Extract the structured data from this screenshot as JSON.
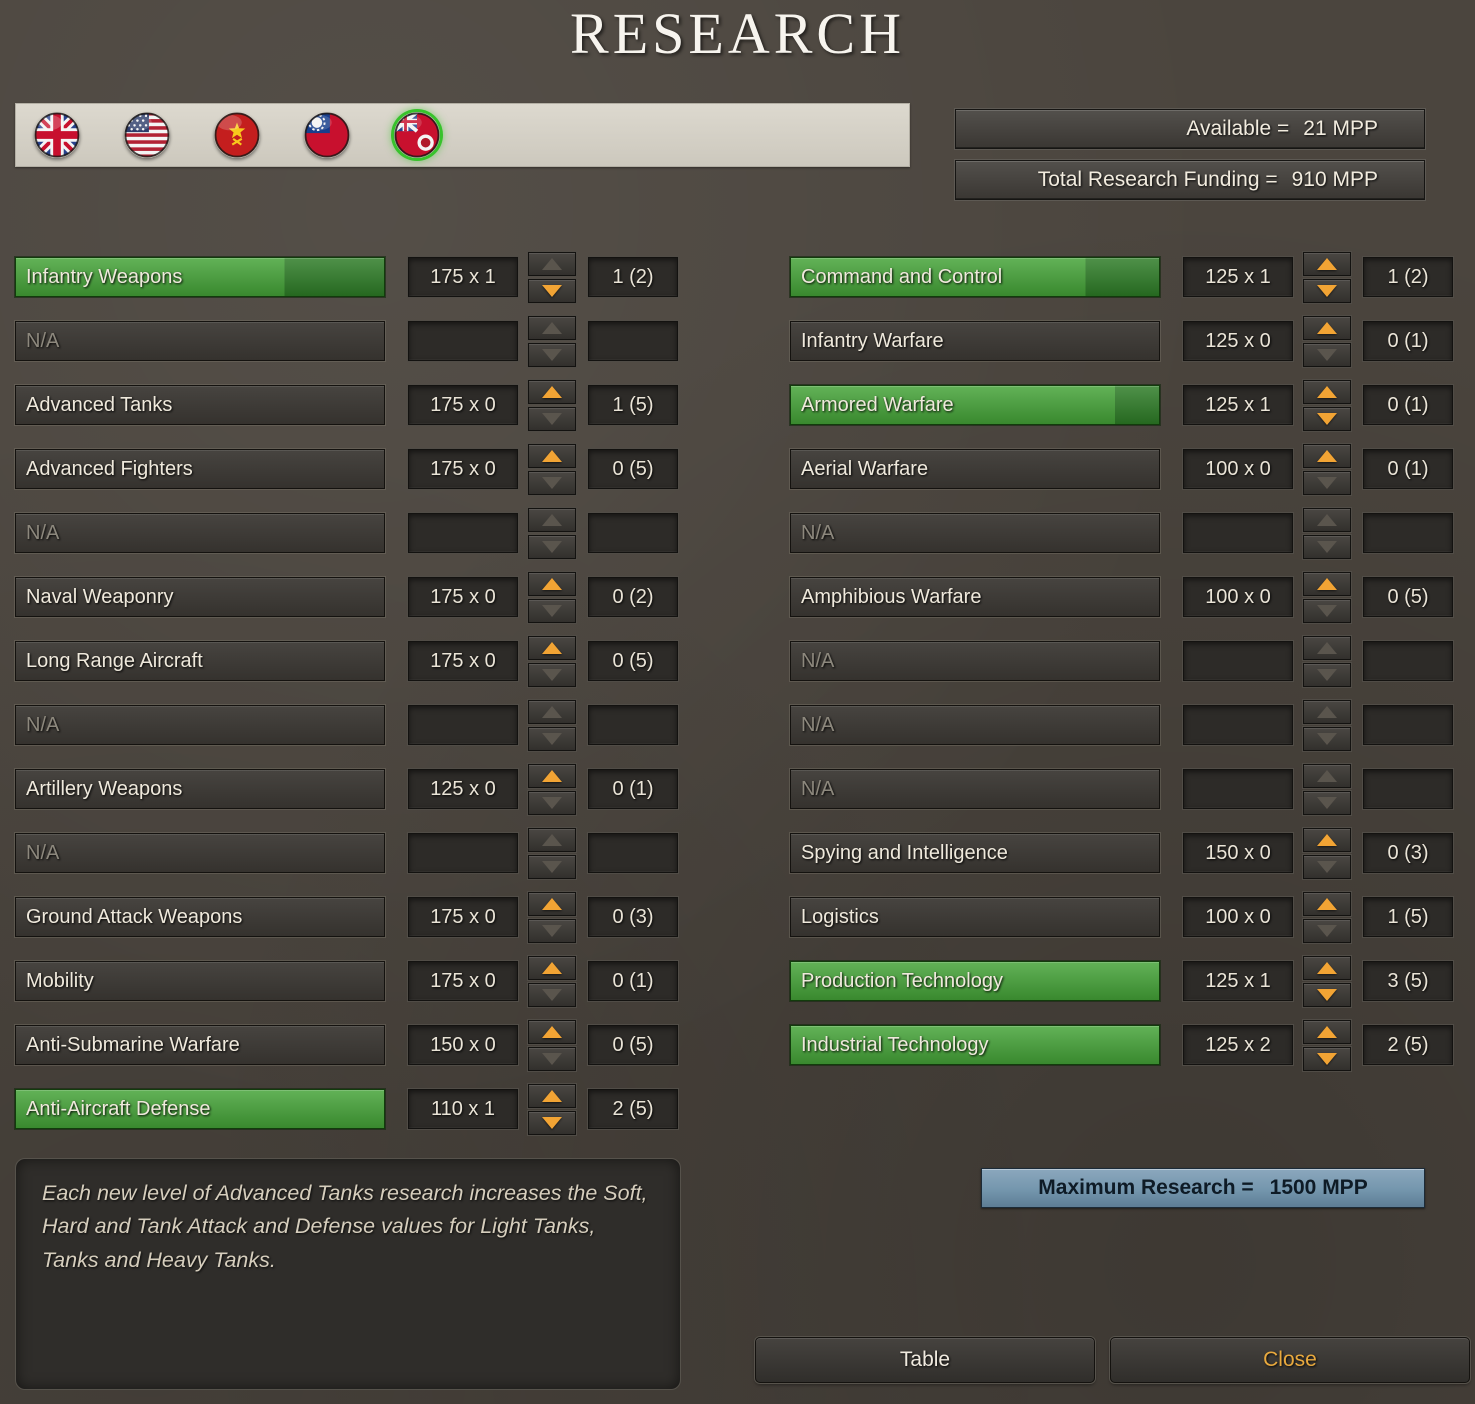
{
  "title": "RESEARCH",
  "flags": [
    {
      "id": "uk",
      "name": "United Kingdom",
      "selected": false
    },
    {
      "id": "usa",
      "name": "United States",
      "selected": false
    },
    {
      "id": "ussr",
      "name": "Soviet Union",
      "selected": false
    },
    {
      "id": "china",
      "name": "China",
      "selected": false
    },
    {
      "id": "selected-nation",
      "name": "Selected Nation",
      "selected": true
    }
  ],
  "funding": {
    "available_label": "Available =",
    "available_value": "21 MPP",
    "total_label": "Total Research Funding =",
    "total_value": "910 MPP"
  },
  "left_rows": [
    {
      "label": "Infantry Weapons",
      "cost": "175 x 1",
      "count": "1 (2)",
      "na": false,
      "highlight": true,
      "progress": 73,
      "up": false,
      "down": true
    },
    {
      "label": "N/A",
      "na": true
    },
    {
      "label": "Advanced Tanks",
      "cost": "175 x 0",
      "count": "1 (5)",
      "na": false,
      "highlight": false,
      "up": true,
      "down": false
    },
    {
      "label": "Advanced Fighters",
      "cost": "175 x 0",
      "count": "0 (5)",
      "na": false,
      "highlight": false,
      "up": true,
      "down": false
    },
    {
      "label": "N/A",
      "na": true
    },
    {
      "label": "Naval Weaponry",
      "cost": "175 x 0",
      "count": "0 (2)",
      "na": false,
      "highlight": false,
      "up": true,
      "down": false
    },
    {
      "label": "Long Range Aircraft",
      "cost": "175 x 0",
      "count": "0 (5)",
      "na": false,
      "highlight": false,
      "up": true,
      "down": false
    },
    {
      "label": "N/A",
      "na": true
    },
    {
      "label": "Artillery Weapons",
      "cost": "125 x 0",
      "count": "0 (1)",
      "na": false,
      "highlight": false,
      "up": true,
      "down": false
    },
    {
      "label": "N/A",
      "na": true
    },
    {
      "label": "Ground Attack Weapons",
      "cost": "175 x 0",
      "count": "0 (3)",
      "na": false,
      "highlight": false,
      "up": true,
      "down": false
    },
    {
      "label": "Mobility",
      "cost": "175 x 0",
      "count": "0 (1)",
      "na": false,
      "highlight": false,
      "up": true,
      "down": false
    },
    {
      "label": "Anti-Submarine Warfare",
      "cost": "150 x 0",
      "count": "0 (5)",
      "na": false,
      "highlight": false,
      "up": true,
      "down": false
    },
    {
      "label": "Anti-Aircraft Defense",
      "cost": "110 x 1",
      "count": "2 (5)",
      "na": false,
      "highlight": true,
      "progress": 100,
      "up": true,
      "down": true
    }
  ],
  "right_rows": [
    {
      "label": "Command and Control",
      "cost": "125 x 1",
      "count": "1 (2)",
      "na": false,
      "highlight": true,
      "progress": 80,
      "up": true,
      "down": true
    },
    {
      "label": "Infantry Warfare",
      "cost": "125 x 0",
      "count": "0 (1)",
      "na": false,
      "highlight": false,
      "up": true,
      "down": false
    },
    {
      "label": "Armored Warfare",
      "cost": "125 x 1",
      "count": "0 (1)",
      "na": false,
      "highlight": true,
      "progress": 88,
      "up": true,
      "down": true
    },
    {
      "label": "Aerial Warfare",
      "cost": "100 x 0",
      "count": "0 (1)",
      "na": false,
      "highlight": false,
      "up": true,
      "down": false
    },
    {
      "label": "N/A",
      "na": true
    },
    {
      "label": "Amphibious Warfare",
      "cost": "100 x 0",
      "count": "0 (5)",
      "na": false,
      "highlight": false,
      "up": true,
      "down": false
    },
    {
      "label": "N/A",
      "na": true
    },
    {
      "label": "N/A",
      "na": true
    },
    {
      "label": "N/A",
      "na": true
    },
    {
      "label": "Spying and Intelligence",
      "cost": "150 x 0",
      "count": "0 (3)",
      "na": false,
      "highlight": false,
      "up": true,
      "down": false
    },
    {
      "label": "Logistics",
      "cost": "100 x 0",
      "count": "1 (5)",
      "na": false,
      "highlight": false,
      "up": true,
      "down": false
    },
    {
      "label": "Production Technology",
      "cost": "125 x 1",
      "count": "3 (5)",
      "na": false,
      "highlight": true,
      "progress": 100,
      "up": true,
      "down": true
    },
    {
      "label": "Industrial Technology",
      "cost": "125 x 2",
      "count": "2 (5)",
      "na": false,
      "highlight": true,
      "progress": 100,
      "up": true,
      "down": true
    }
  ],
  "description": "Each new level of Advanced Tanks research increases the Soft, Hard and Tank Attack and Defense values for Light Tanks, Tanks and Heavy Tanks.",
  "maximum": {
    "label": "Maximum Research =",
    "value": "1500 MPP"
  },
  "buttons": {
    "table": "Table",
    "close": "Close"
  },
  "colors": {
    "green_light": "#44a337",
    "green_dark": "#2d7c26",
    "arrow_active": "#f2a434",
    "arrow_disabled": "#5a554d",
    "close_text": "#e8a93e",
    "max_bar_blue": "#7496ad"
  }
}
